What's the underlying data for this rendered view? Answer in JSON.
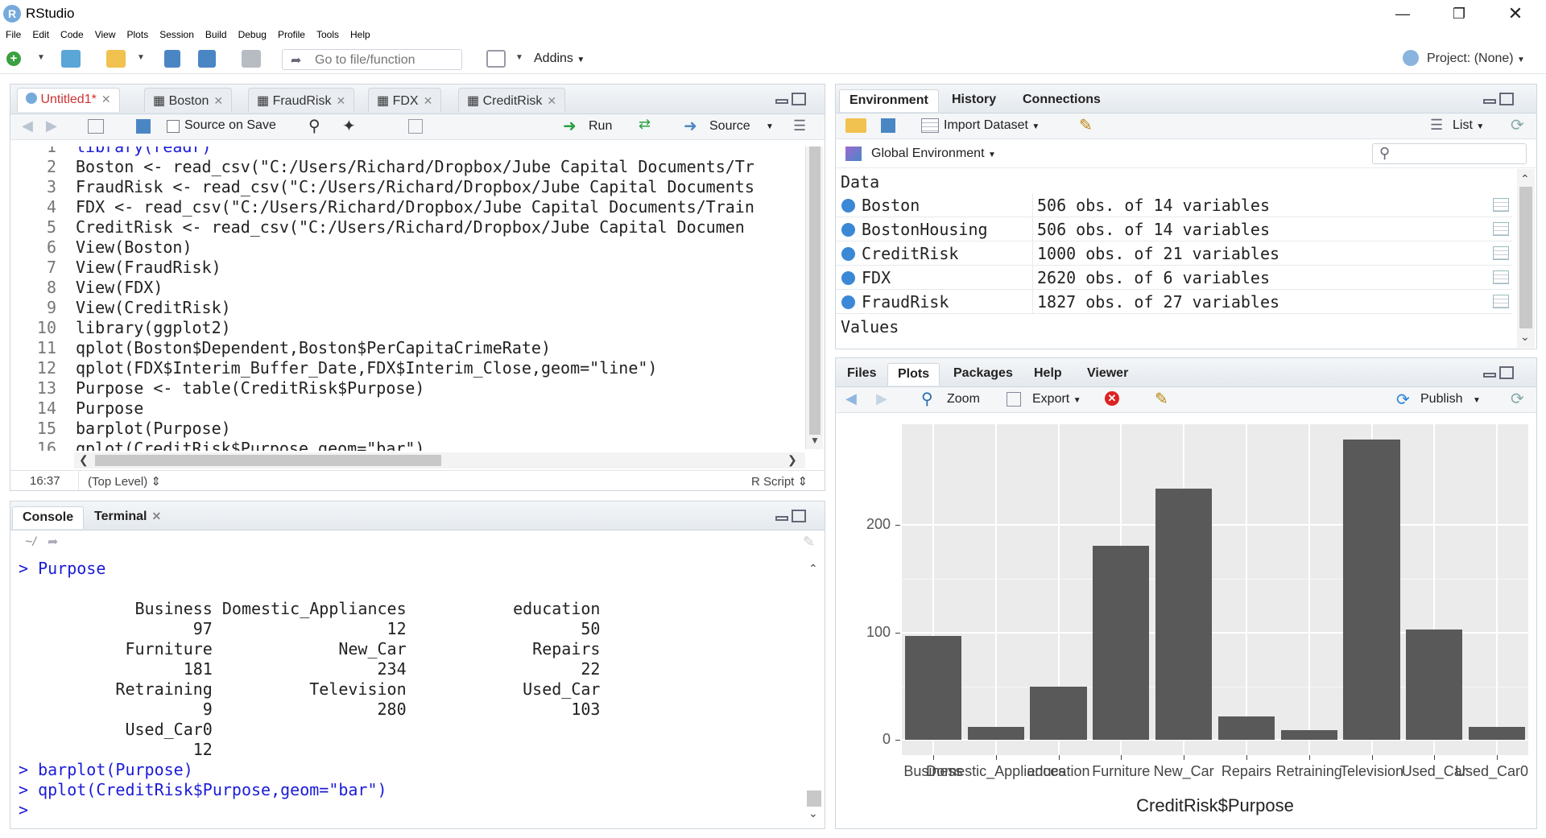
{
  "window": {
    "title": "RStudio",
    "logo": "R",
    "controls": [
      "minimize-icon",
      "restore-icon",
      "close-icon"
    ]
  },
  "menu": [
    "File",
    "Edit",
    "Code",
    "View",
    "Plots",
    "Session",
    "Build",
    "Debug",
    "Profile",
    "Tools",
    "Help"
  ],
  "toolbar": {
    "goto_placeholder": "Go to file/function",
    "addins": "Addins",
    "project": "Project: (None)"
  },
  "editor": {
    "tabs": [
      "Untitled1*",
      "Boston",
      "FraudRisk",
      "FDX",
      "CreditRisk"
    ],
    "source_on_save": "Source on Save",
    "run": "Run",
    "source": "Source",
    "lines": [
      {
        "n": "2",
        "text": "Boston <- read_csv(\"C:/Users/Richard/Dropbox/Jube Capital Documents/Tr"
      },
      {
        "n": "3",
        "text": "FraudRisk <- read_csv(\"C:/Users/Richard/Dropbox/Jube Capital Documents"
      },
      {
        "n": "4",
        "text": "FDX <- read_csv(\"C:/Users/Richard/Dropbox/Jube Capital Documents/Train"
      },
      {
        "n": "5",
        "text": "CreditRisk <- read_csv(\"C:/Users/Richard/Dropbox/Jube Capital Documen"
      },
      {
        "n": "6",
        "text": "View(Boston)"
      },
      {
        "n": "7",
        "text": "View(FraudRisk)"
      },
      {
        "n": "8",
        "text": "View(FDX)"
      },
      {
        "n": "9",
        "text": "View(CreditRisk)"
      },
      {
        "n": "10",
        "text": "library(ggplot2)"
      },
      {
        "n": "11",
        "text": "qplot(Boston$Dependent,Boston$PerCapitaCrimeRate)"
      },
      {
        "n": "12",
        "text": "qplot(FDX$Interim_Buffer_Date,FDX$Interim_Close,geom=\"line\")"
      },
      {
        "n": "13",
        "text": "Purpose <- table(CreditRisk$Purpose)"
      },
      {
        "n": "14",
        "text": "Purpose"
      },
      {
        "n": "15",
        "text": "barplot(Purpose)"
      },
      {
        "n": "16",
        "text": "qplot(CreditRisk$Purpose,geom=\"bar\")"
      }
    ],
    "status_pos": "16:37",
    "status_scope": "(Top Level)",
    "status_type": "R Script"
  },
  "console": {
    "tabs": [
      "Console",
      "Terminal"
    ],
    "path": "~/",
    "lines": [
      "> Purpose",
      "",
      "            Business Domestic_Appliances           education",
      "                  97                  12                  50",
      "           Furniture             New_Car             Repairs",
      "                 181                 234                  22",
      "          Retraining          Television            Used_Car",
      "                   9                 280                 103",
      "           Used_Car0",
      "                  12",
      "> barplot(Purpose)",
      "> qplot(CreditRisk$Purpose,geom=\"bar\")",
      ">"
    ]
  },
  "environment": {
    "tabs": [
      "Environment",
      "History",
      "Connections"
    ],
    "import": "Import Dataset",
    "view_mode": "List",
    "scope": "Global Environment",
    "section_data": "Data",
    "section_values": "Values",
    "rows": [
      {
        "name": "Boston",
        "value": "506 obs. of 14 variables"
      },
      {
        "name": "BostonHousing",
        "value": "506 obs. of 14 variables"
      },
      {
        "name": "CreditRisk",
        "value": "1000 obs. of 21 variables"
      },
      {
        "name": "FDX",
        "value": "2620 obs. of 6 variables"
      },
      {
        "name": "FraudRisk",
        "value": "1827 obs. of 27 variables"
      }
    ]
  },
  "plots": {
    "tabs": [
      "Files",
      "Plots",
      "Packages",
      "Help",
      "Viewer"
    ],
    "zoom": "Zoom",
    "export": "Export",
    "publish": "Publish"
  },
  "chart_data": {
    "type": "bar",
    "categories": [
      "Business",
      "Domestic_Appliances",
      "education",
      "Furniture",
      "New_Car",
      "Repairs",
      "Retraining",
      "Television",
      "Used_Car",
      "Used_Car0"
    ],
    "values": [
      97,
      12,
      50,
      181,
      234,
      22,
      9,
      280,
      103,
      12
    ],
    "xlabel": "CreditRisk$Purpose",
    "ylabel": "",
    "yticks": [
      0,
      100,
      200
    ],
    "ylim": [
      -14,
      294
    ],
    "bar_color": "#595959",
    "panel_color": "#EBEBEB",
    "grid": true
  }
}
